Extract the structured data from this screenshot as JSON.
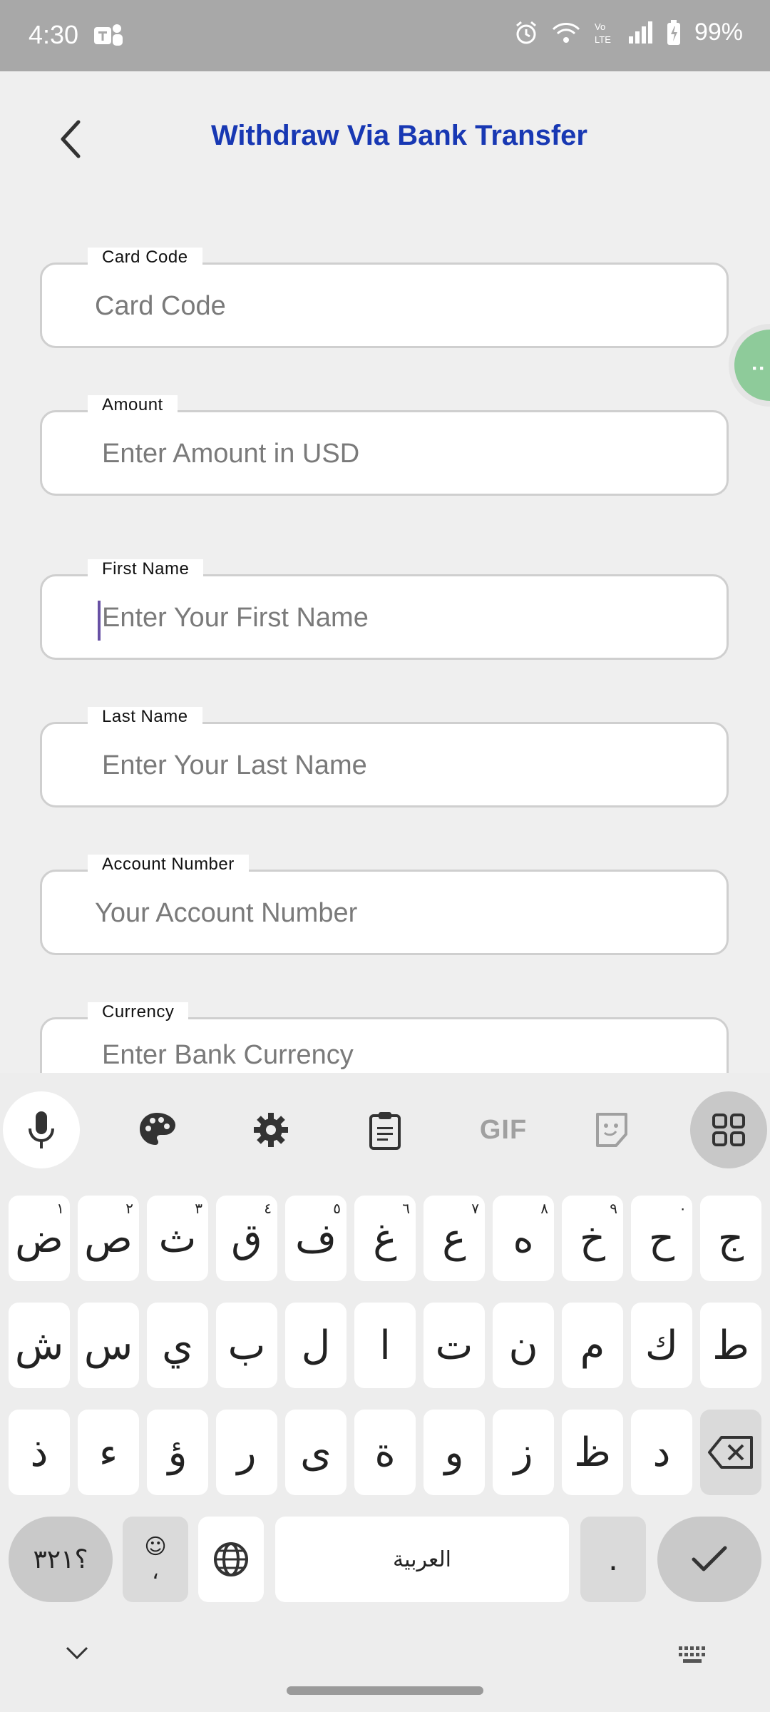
{
  "status": {
    "time": "4:30",
    "battery": "99%",
    "icons": [
      "teams-icon",
      "alarm-icon",
      "wifi-icon",
      "volte-icon",
      "signal-icon",
      "battery-icon"
    ]
  },
  "header": {
    "title": "Withdraw Via Bank Transfer"
  },
  "form": {
    "card_code": {
      "label": "Card Code",
      "placeholder": "Card Code"
    },
    "amount": {
      "label": "Amount",
      "placeholder": "Enter Amount in USD"
    },
    "first_name": {
      "label": "First Name",
      "placeholder": "Enter Your First Name"
    },
    "last_name": {
      "label": "Last Name",
      "placeholder": "Enter Your Last Name"
    },
    "account_number": {
      "label": "Account Number",
      "placeholder": "Your Account Number"
    },
    "currency": {
      "label": "Currency",
      "placeholder": "Enter Bank Currency"
    }
  },
  "keyboard": {
    "toolbar": [
      "mic-icon",
      "palette-icon",
      "gear-icon",
      "clipboard-icon",
      "gif-icon",
      "sticker-icon",
      "apps-grid-icon"
    ],
    "gif_label": "GIF",
    "row1": [
      {
        "k": "ض",
        "h": "١"
      },
      {
        "k": "ص",
        "h": "٢"
      },
      {
        "k": "ث",
        "h": "٣"
      },
      {
        "k": "ق",
        "h": "٤"
      },
      {
        "k": "ف",
        "h": "٥"
      },
      {
        "k": "غ",
        "h": "٦"
      },
      {
        "k": "ع",
        "h": "٧"
      },
      {
        "k": "ه",
        "h": "٨"
      },
      {
        "k": "خ",
        "h": "٩"
      },
      {
        "k": "ح",
        "h": "٠"
      },
      {
        "k": "ج",
        "h": ""
      }
    ],
    "row2": [
      "ش",
      "س",
      "ي",
      "ب",
      "ل",
      "ا",
      "ت",
      "ن",
      "م",
      "ك",
      "ط"
    ],
    "row3": [
      "ذ",
      "ء",
      "ؤ",
      "ر",
      "ى",
      "ة",
      "و",
      "ز",
      "ظ",
      "د"
    ],
    "symbols_label": "؟٣٢١",
    "comma_label": "،",
    "space_label": "العربية",
    "period_label": "."
  }
}
